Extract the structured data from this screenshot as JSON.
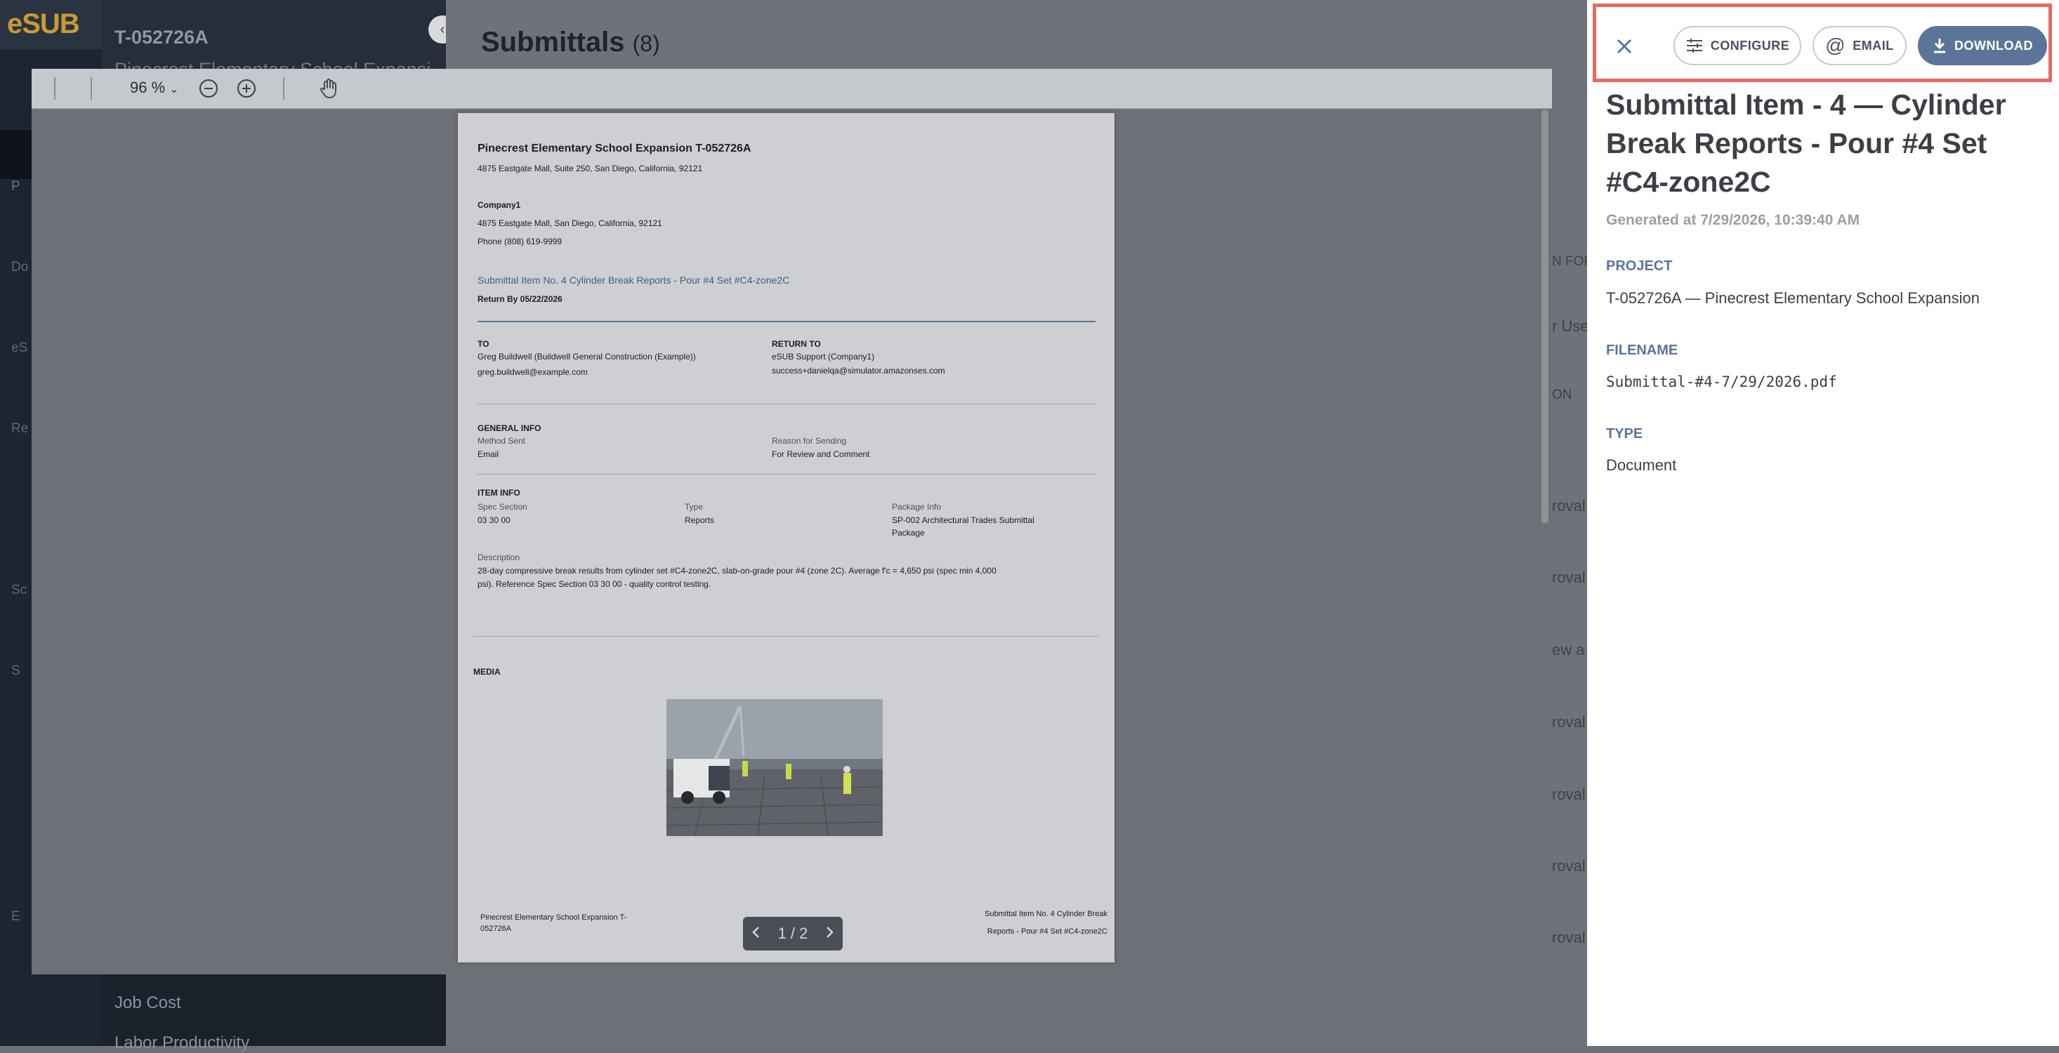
{
  "app": {
    "logo": "eSUB",
    "project_code": "T-052726A",
    "project_name": "Pinecrest Elementary School Expansion",
    "rail_labels": [
      "P",
      "Do",
      "eS",
      "Re",
      "Sc",
      "S",
      "E"
    ],
    "nav_items": [
      "Job Cost",
      "Labor Productivity"
    ]
  },
  "main": {
    "title": "Submittals",
    "count": "(8)",
    "partial_column": [
      "N FOR",
      "r Use",
      "ON",
      "roval",
      "roval",
      "ew a",
      "roval",
      "roval",
      "roval",
      "roval"
    ]
  },
  "viewer": {
    "zoom": "96 %",
    "page_indicator": "1 / 2",
    "document": {
      "project_header": "Pinecrest Elementary School Expansion T-052726A",
      "project_address": "4875 Eastgate Mall, Suite 250, San Diego, California, 92121",
      "company": "Company1",
      "company_address": "4875 Eastgate Mall, San Diego, California, 92121",
      "company_phone": "Phone (808) 619-9999",
      "item_title": "Submittal Item No. 4 Cylinder Break Reports - Pour #4 Set #C4-zone2C",
      "return_by": "Return By 05/22/2026",
      "to_label": "TO",
      "to_name": "Greg Buildwell (Buildwell General Construction (Example))",
      "to_email": "greg.buildwell@example.com",
      "return_to_label": "RETURN TO",
      "return_to_name": "eSUB Support (Company1)",
      "return_to_email": "success+danielqa@simulator.amazonses.com",
      "general_info_label": "GENERAL INFO",
      "method_sent_label": "Method Sent",
      "method_sent": "Email",
      "reason_label": "Reason for Sending",
      "reason": "For Review and Comment",
      "item_info_label": "ITEM INFO",
      "spec_section_label": "Spec Section",
      "spec_section": "03 30 00",
      "type_label": "Type",
      "type": "Reports",
      "package_label": "Package Info",
      "package_line1": "SP-002 Architectural Trades Submittal",
      "package_line2": "Package",
      "description_label": "Description",
      "description_line1": "28-day compressive break results from cylinder set #C4-zone2C, slab-on-grade pour #4 (zone 2C). Average f'c = 4,650 psi (spec min 4,000",
      "description_line2": "psi). Reference Spec Section 03 30 00 - quality control testing.",
      "media_label": "MEDIA",
      "footer_left_line1": "Pinecrest Elementary School Expansion T-",
      "footer_left_line2": "052726A",
      "footer_right_line1": "Submittal Item No. 4 Cylinder Break",
      "footer_right_line2": "Reports - Pour #4 Set #C4-zone2C"
    }
  },
  "panel": {
    "configure_label": "CONFIGURE",
    "email_label": "EMAIL",
    "download_label": "DOWNLOAD",
    "title": "Submittal Item - 4 — Cylinder Break Reports - Pour #4 Set #C4-zone2C",
    "generated": "Generated at 7/29/2026, 10:39:40 AM",
    "project_label": "PROJECT",
    "project_value": "T-052726A — Pinecrest Elementary School Expansion",
    "filename_label": "FILENAME",
    "filename_value": "Submittal-#4-7/29/2026.pdf",
    "type_label": "TYPE",
    "type_value": "Document"
  },
  "colors": {
    "accent": "#5b7599",
    "highlight_border": "#e66a60",
    "logo": "#c79a34"
  }
}
